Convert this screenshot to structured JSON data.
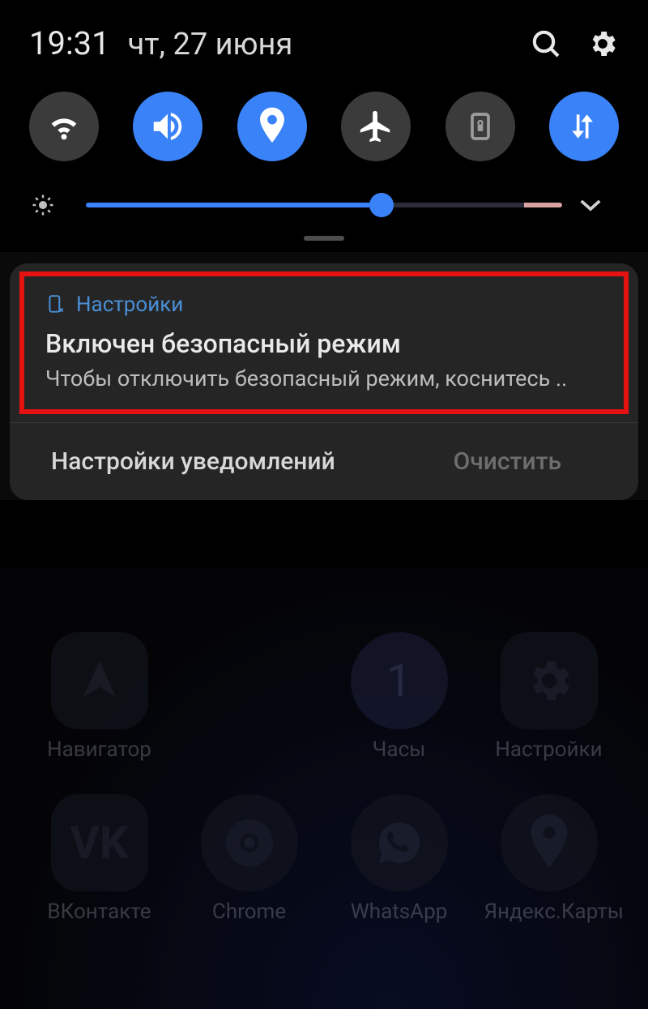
{
  "statusbar": {
    "time": "19:31",
    "date": "чт, 27 июня"
  },
  "quick_toggles": [
    {
      "name": "wifi",
      "active": false
    },
    {
      "name": "sound",
      "active": true
    },
    {
      "name": "location",
      "active": true
    },
    {
      "name": "airplane",
      "active": false
    },
    {
      "name": "rotation",
      "active": false
    },
    {
      "name": "data",
      "active": true
    }
  ],
  "brightness_percent": 62,
  "notification": {
    "app_name": "Настройки",
    "title": "Включен безопасный режим",
    "body": "Чтобы отключить безопасный режим, коснитесь .."
  },
  "notif_actions": {
    "settings_label": "Настройки уведомлений",
    "clear_label": "Очистить"
  },
  "home_apps_row1": [
    {
      "label": "Навигатор"
    },
    {
      "label": ""
    },
    {
      "label": "Часы"
    },
    {
      "label": "Настройки"
    }
  ],
  "home_apps_row2": [
    {
      "label": "ВКонтакте"
    },
    {
      "label": "Chrome"
    },
    {
      "label": "WhatsApp"
    },
    {
      "label": "Яндекс.Карты"
    }
  ]
}
